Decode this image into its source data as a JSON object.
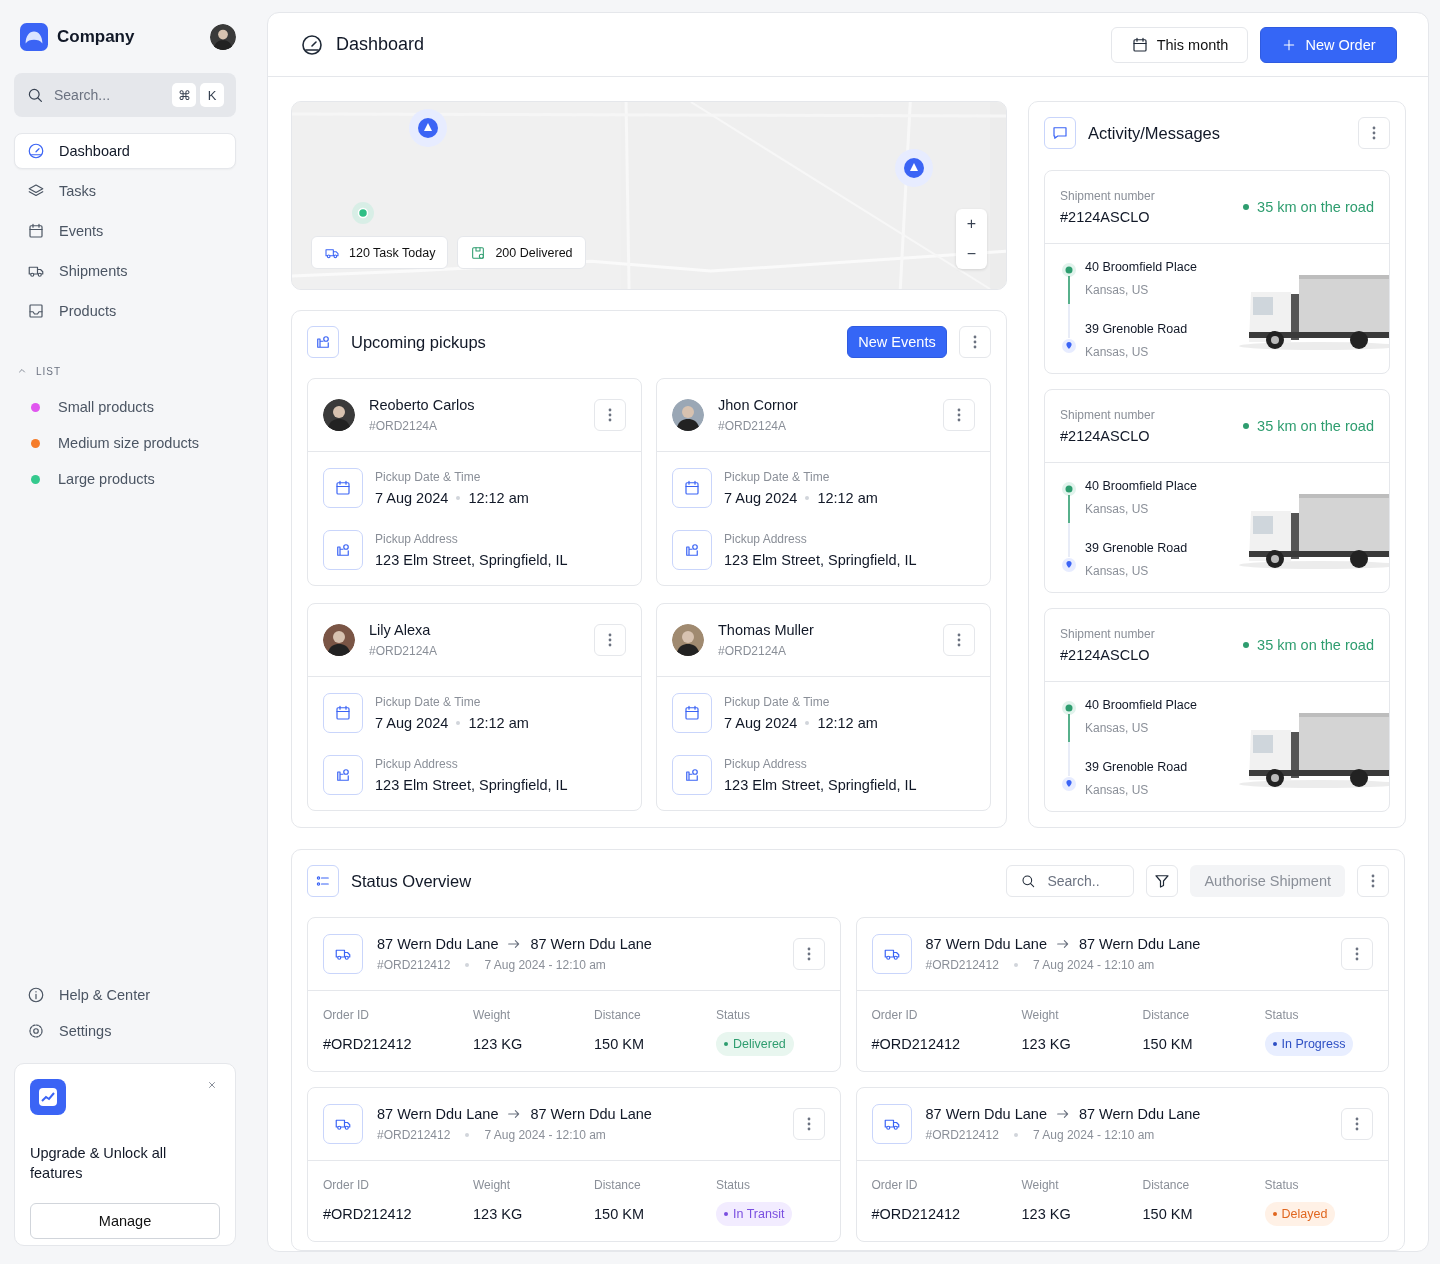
{
  "sidebar": {
    "brand": "Company",
    "search": {
      "placeholder": "Search...",
      "keys": [
        "⌘",
        "K"
      ]
    },
    "nav": [
      {
        "label": "Dashboard",
        "selected": true
      },
      {
        "label": "Tasks",
        "selected": false
      },
      {
        "label": "Events",
        "selected": false
      },
      {
        "label": "Shipments",
        "selected": false
      },
      {
        "label": "Products",
        "selected": false
      }
    ],
    "list": {
      "heading": "LIST",
      "expanded": true,
      "items": [
        {
          "label": "Small products",
          "color": "#e056ef"
        },
        {
          "label": "Medium size products",
          "color": "#f57c2a"
        },
        {
          "label": "Large products",
          "color": "#34c98e"
        }
      ]
    },
    "footer_nav": [
      "Help & Center",
      "Settings"
    ],
    "promo": {
      "text": "Upgrade & Unlock all features",
      "button": "Manage"
    }
  },
  "header": {
    "title": "Dashboard",
    "period": "This month",
    "action": "New Order"
  },
  "map": {
    "kind": "picture",
    "chips": [
      {
        "kind": "tasks",
        "label": "120 Task Today"
      },
      {
        "kind": "delivered",
        "label": "200 Delivered"
      }
    ],
    "zoom": [
      "+",
      "−"
    ]
  },
  "pickups": {
    "title": "Upcoming pickups",
    "action": "New Events",
    "cards": [
      {
        "name": "Reoberto Carlos",
        "order": "#ORD2124A",
        "date_label": "Pickup Date & Time",
        "date": "7 Aug 2024",
        "time": "12:12 am",
        "address_label": "Pickup Address",
        "address": "123 Elm Street, Springfield, IL"
      },
      {
        "name": "Jhon Cornor",
        "order": "#ORD2124A",
        "date_label": "Pickup Date & Time",
        "date": "7 Aug 2024",
        "time": "12:12 am",
        "address_label": "Pickup Address",
        "address": "123 Elm Street, Springfield, IL"
      },
      {
        "name": "Lily Alexa",
        "order": "#ORD2124A",
        "date_label": "Pickup Date & Time",
        "date": "7 Aug 2024",
        "time": "12:12 am",
        "address_label": "Pickup Address",
        "address": "123 Elm Street, Springfield, IL"
      },
      {
        "name": "Thomas Muller",
        "order": "#ORD2124A",
        "date_label": "Pickup Date & Time",
        "date": "7 Aug 2024",
        "time": "12:12 am",
        "address_label": "Pickup Address",
        "address": "123 Elm Street, Springfield, IL"
      }
    ]
  },
  "activity": {
    "title": "Activity/Messages",
    "shipments": [
      {
        "label": "Shipment number",
        "number": "#2124ASCLO",
        "distance": "35 km on the road",
        "from": "40 Broomfield Place",
        "from_region": "Kansas, US",
        "to": "39 Grenoble Road",
        "to_region": "Kansas, US"
      },
      {
        "label": "Shipment number",
        "number": "#2124ASCLO",
        "distance": "35 km on the road",
        "from": "40 Broomfield Place",
        "from_region": "Kansas, US",
        "to": "39 Grenoble Road",
        "to_region": "Kansas, US"
      },
      {
        "label": "Shipment number",
        "number": "#2124ASCLO",
        "distance": "35 km on the road",
        "from": "40 Broomfield Place",
        "from_region": "Kansas, US",
        "to": "39 Grenoble Road",
        "to_region": "Kansas, US"
      }
    ]
  },
  "status": {
    "title": "Status Overview",
    "search": {
      "placeholder": "Search.."
    },
    "action": {
      "label": "Authorise Shipment",
      "disabled": true
    },
    "orders": [
      {
        "from": "87 Wern Ddu Lane",
        "to": "87 Wern Ddu Lane",
        "order": "#ORD212412",
        "datetime": "7 Aug 2024 - 12:10 am",
        "labels": [
          "Order ID",
          "Weight",
          "Distance",
          "Status"
        ],
        "order_id": "#ORD212412",
        "weight": "123 KG",
        "distance": "150 KM",
        "status": {
          "kind": "delivered",
          "label": "Delivered"
        }
      },
      {
        "from": "87 Wern Ddu Lane",
        "to": "87 Wern Ddu Lane",
        "order": "#ORD212412",
        "datetime": "7 Aug 2024 - 12:10 am",
        "labels": [
          "Order ID",
          "Weight",
          "Distance",
          "Status"
        ],
        "order_id": "#ORD212412",
        "weight": "123 KG",
        "distance": "150 KM",
        "status": {
          "kind": "progress",
          "label": "In Progress"
        }
      },
      {
        "from": "87 Wern Ddu Lane",
        "to": "87 Wern Ddu Lane",
        "order": "#ORD212412",
        "datetime": "7 Aug 2024 - 12:10 am",
        "labels": [
          "Order ID",
          "Weight",
          "Distance",
          "Status"
        ],
        "order_id": "#ORD212412",
        "weight": "123 KG",
        "distance": "150 KM",
        "status": {
          "kind": "transit",
          "label": "In Transit"
        }
      },
      {
        "from": "87 Wern Ddu Lane",
        "to": "87 Wern Ddu Lane",
        "order": "#ORD212412",
        "datetime": "7 Aug 2024 - 12:10 am",
        "labels": [
          "Order ID",
          "Weight",
          "Distance",
          "Status"
        ],
        "order_id": "#ORD212412",
        "weight": "123 KG",
        "distance": "150 KM",
        "status": {
          "kind": "delayed",
          "label": "Delayed"
        }
      }
    ]
  }
}
